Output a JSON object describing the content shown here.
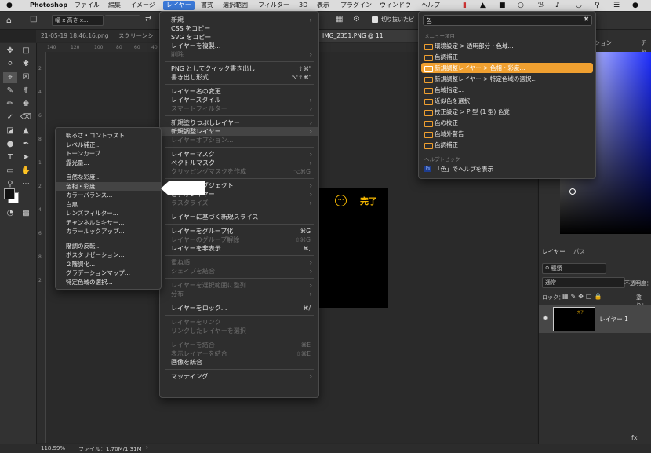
{
  "menubar": {
    "apple": "",
    "app": "Photoshop",
    "items": [
      "ファイル",
      "編集",
      "イメージ",
      "レイヤー",
      "書式",
      "選択範囲",
      "フィルター",
      "3D",
      "表示",
      "プラグイン",
      "ウィンドウ",
      "ヘルプ"
    ],
    "selected": "レイヤー"
  },
  "optbar": {
    "ratio_field": "幅 x 高さ x...",
    "straighten_label": "切り抜いたピ"
  },
  "tabs": [
    "21-05-19 18.46.16.png",
    "スクリーンシ",
    "IMG_2351.PNG @ 11"
  ],
  "ruler_labels": [
    "140",
    "120",
    "100",
    "80",
    "60",
    "40",
    "20"
  ],
  "vruler_labels": [
    "2",
    "4",
    "6",
    "8",
    "1",
    "2",
    "4",
    "6",
    "8",
    "2"
  ],
  "layer_menu": {
    "items": [
      {
        "label": "新規",
        "arrow": true
      },
      {
        "label": "CSS をコピー"
      },
      {
        "label": "SVG をコピー"
      },
      {
        "label": "レイヤーを複製..."
      },
      {
        "label": "削除",
        "disabled": true,
        "arrow": true
      },
      {
        "sep": true
      },
      {
        "label": "PNG としてクイック書き出し",
        "shortcut": "⇧⌘'"
      },
      {
        "label": "書き出し形式...",
        "shortcut": "⌥⇧⌘'"
      },
      {
        "sep": true
      },
      {
        "label": "レイヤー名の変更..."
      },
      {
        "label": "レイヤースタイル",
        "arrow": true
      },
      {
        "label": "スマートフィルター",
        "disabled": true,
        "arrow": true
      },
      {
        "sep": true
      },
      {
        "label": "新規塗りつぶしレイヤー",
        "arrow": true
      },
      {
        "label": "新規調整レイヤー",
        "arrow": true,
        "highlight": true
      },
      {
        "label": "レイヤーオプション...",
        "disabled": true
      },
      {
        "sep": true
      },
      {
        "label": "レイヤーマスク",
        "arrow": true
      },
      {
        "label": "ベクトルマスク",
        "arrow": true
      },
      {
        "label": "クリッピングマスクを作成",
        "disabled": true,
        "shortcut": "⌥⌘G"
      },
      {
        "sep": true
      },
      {
        "label": "スマートオブジェクト",
        "arrow": true
      },
      {
        "label": "ビデオレイヤー",
        "arrow": true
      },
      {
        "label": "ラスタライズ",
        "disabled": true,
        "arrow": true
      },
      {
        "sep": true
      },
      {
        "label": "レイヤーに基づく新規スライス"
      },
      {
        "sep": true
      },
      {
        "label": "レイヤーをグループ化",
        "shortcut": "⌘G"
      },
      {
        "label": "レイヤーのグループ解除",
        "disabled": true,
        "shortcut": "⇧⌘G"
      },
      {
        "label": "レイヤーを非表示",
        "shortcut": "⌘,"
      },
      {
        "sep": true
      },
      {
        "label": "重ね順",
        "disabled": true,
        "arrow": true
      },
      {
        "label": "シェイプを結合",
        "disabled": true,
        "arrow": true
      },
      {
        "sep": true
      },
      {
        "label": "レイヤーを選択範囲に整列",
        "disabled": true,
        "arrow": true
      },
      {
        "label": "分布",
        "disabled": true,
        "arrow": true
      },
      {
        "sep": true
      },
      {
        "label": "レイヤーをロック...",
        "shortcut": "⌘/"
      },
      {
        "sep": true
      },
      {
        "label": "レイヤーをリンク",
        "disabled": true
      },
      {
        "label": "リンクしたレイヤーを選択",
        "disabled": true
      },
      {
        "sep": true
      },
      {
        "label": "レイヤーを結合",
        "disabled": true,
        "shortcut": "⌘E"
      },
      {
        "label": "表示レイヤーを結合",
        "disabled": true,
        "shortcut": "⇧⌘E"
      },
      {
        "label": "画像を統合"
      },
      {
        "sep": true
      },
      {
        "label": "マッティング",
        "arrow": true
      }
    ]
  },
  "adjust_submenu": {
    "items": [
      {
        "label": "明るさ・コントラスト..."
      },
      {
        "label": "レベル補正..."
      },
      {
        "label": "トーンカーブ..."
      },
      {
        "label": "露光量..."
      },
      {
        "sep": true
      },
      {
        "label": "自然な彩度..."
      },
      {
        "label": "色相・彩度...",
        "highlight": true
      },
      {
        "label": "カラーバランス..."
      },
      {
        "label": "白黒..."
      },
      {
        "label": "レンズフィルター..."
      },
      {
        "label": "チャンネルミキサー..."
      },
      {
        "label": "カラールックアップ..."
      },
      {
        "sep": true
      },
      {
        "label": "階調の反転..."
      },
      {
        "label": "ポスタリゼーション..."
      },
      {
        "label": "２階調化..."
      },
      {
        "label": "グラデーションマップ..."
      },
      {
        "label": "特定色域の選択..."
      }
    ]
  },
  "help_menu": {
    "search_value": "色",
    "section_menu": "メニュー項目",
    "items": [
      {
        "label": "環境設定 > 透明部分・色域..."
      },
      {
        "label": "色調補正"
      },
      {
        "label": "新規調整レイヤー > 色相・彩度...",
        "highlight": true
      },
      {
        "label": "新規調整レイヤー > 特定色域の選択..."
      },
      {
        "label": "色域指定..."
      },
      {
        "label": "近似色を選択"
      },
      {
        "label": "校正設定 > P 型 (1 型) 色覚"
      },
      {
        "label": "色の校正"
      },
      {
        "label": "色域外警告"
      },
      {
        "label": "色調補正"
      }
    ],
    "section_help": "ヘルプトピック",
    "help_item": "「色」でヘルプを表示"
  },
  "canvas": {
    "done_label": "完了",
    "more_icon": "ellipsis-circle-icon"
  },
  "status": {
    "zoom": "118.59%",
    "file_info": "ファイル：1.70M/1.31M"
  },
  "right_panel": {
    "action_tab": "アクション",
    "other_tab": "チャ",
    "layers_tab": "レイヤー",
    "paths_tab": "パス",
    "kind_filter": "種類",
    "blend_mode": "通常",
    "opacity_label": "不透明度：",
    "lock_label": "ロック：",
    "fill_label": "塗り：",
    "layer_name": "レイヤー 1",
    "layer_thumb_text": "完了"
  },
  "colors": {
    "accent": "#f0a030",
    "menubar_selected": "#3b79d8",
    "menu_bg": "#2e2e2e",
    "done_yellow": "#f3b600"
  }
}
